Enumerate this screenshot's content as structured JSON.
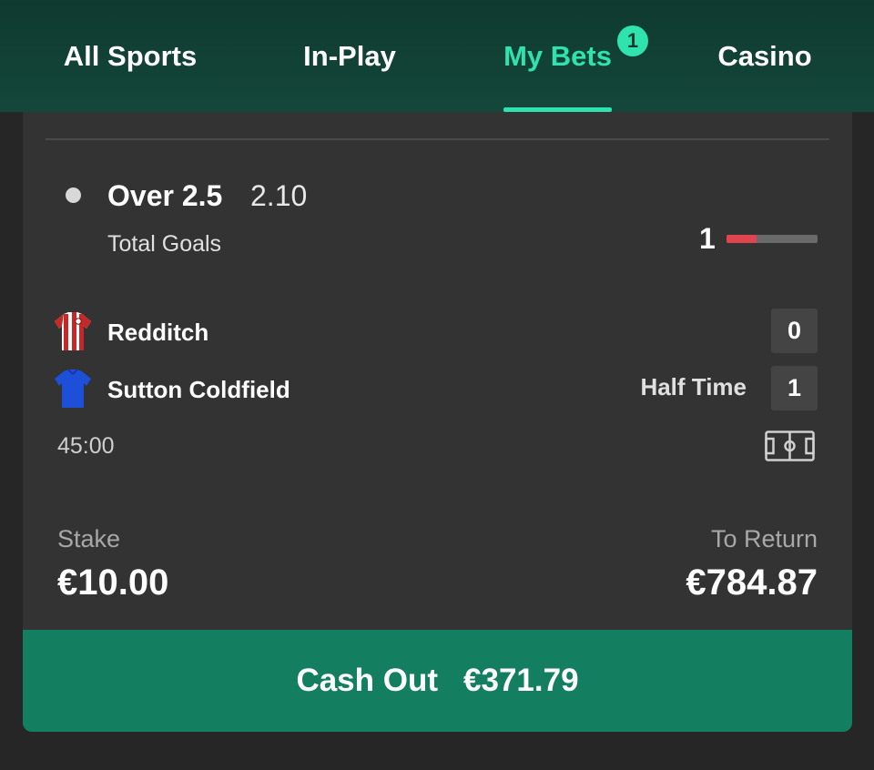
{
  "nav": {
    "items": [
      {
        "label": "All Sports"
      },
      {
        "label": "In-Play"
      },
      {
        "label": "My Bets",
        "badge": "1"
      },
      {
        "label": "Casino"
      }
    ],
    "active_color": "#2fe3ae"
  },
  "bet": {
    "selection": "Over 2.5",
    "odds": "2.10",
    "market": "Total Goals",
    "goals_count": "1",
    "goals_progress": 0.33,
    "progress_color": "#e0454f"
  },
  "match": {
    "home": {
      "name": "Redditch",
      "score": "0",
      "kit_color": "#c62828"
    },
    "away": {
      "name": "Sutton Coldfield",
      "score": "1",
      "kit_color": "#1e4fd8"
    },
    "status": "Half Time",
    "clock": "45:00",
    "pitch_icon": "pitch-icon"
  },
  "stake": {
    "label": "Stake",
    "value": "€10.00"
  },
  "to_return": {
    "label": "To Return",
    "value": "€784.87"
  },
  "cashout": {
    "label": "Cash Out",
    "amount": "€371.79",
    "color": "#137f60"
  }
}
